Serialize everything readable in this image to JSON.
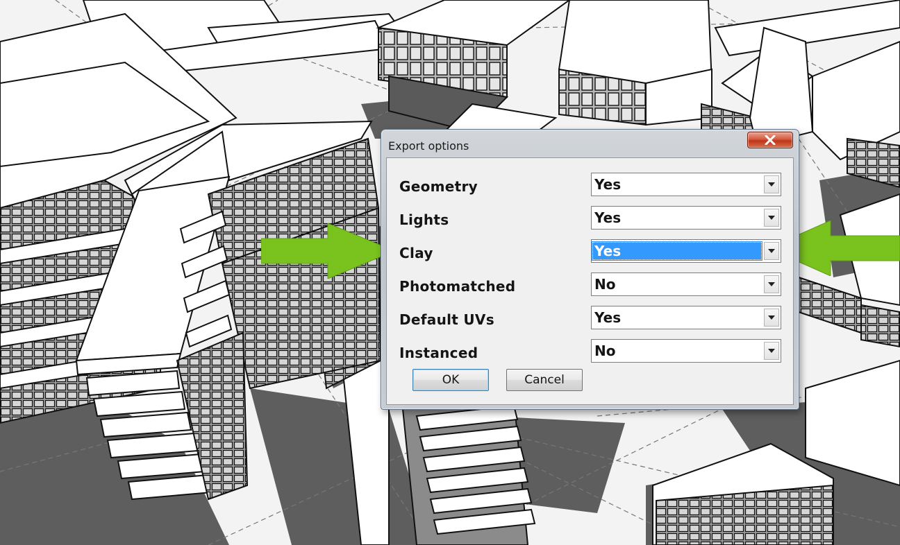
{
  "dialog": {
    "title": "Export options",
    "close_icon": "close-x-icon",
    "options": [
      {
        "label": "Geometry",
        "value": "Yes"
      },
      {
        "label": "Lights",
        "value": "Yes"
      },
      {
        "label": "Clay",
        "value": "Yes",
        "selected": true
      },
      {
        "label": "Photomatched",
        "value": "No"
      },
      {
        "label": "Default UVs",
        "value": "Yes"
      },
      {
        "label": "Instanced",
        "value": "No"
      }
    ],
    "ok_label": "OK",
    "cancel_label": "Cancel"
  },
  "annotations": {
    "arrow_color": "#7ac21e",
    "arrow_icons": [
      "arrow-right-icon",
      "arrow-left-icon"
    ]
  },
  "colors": {
    "selection": "#3399ff",
    "close_button": "#c8401f"
  }
}
